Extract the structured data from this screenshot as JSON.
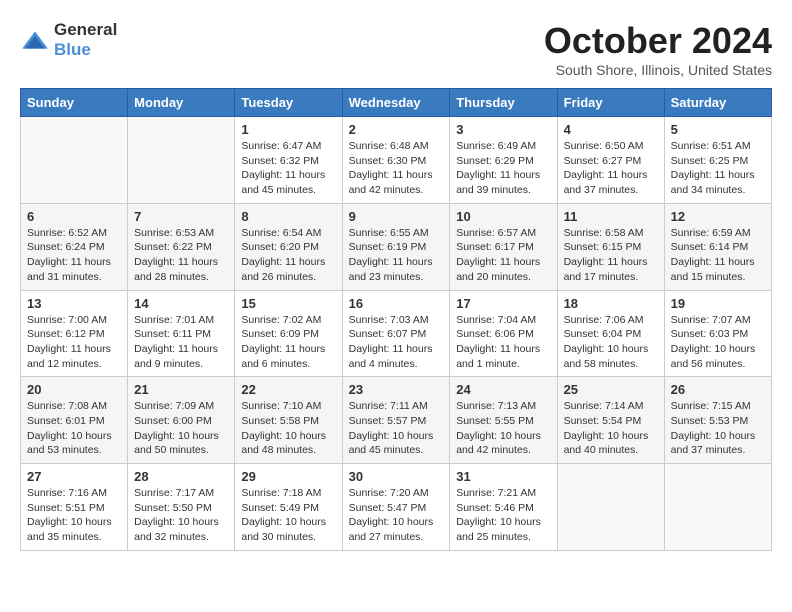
{
  "header": {
    "logo": {
      "general": "General",
      "blue": "Blue"
    },
    "title": "October 2024",
    "location": "South Shore, Illinois, United States"
  },
  "weekdays": [
    "Sunday",
    "Monday",
    "Tuesday",
    "Wednesday",
    "Thursday",
    "Friday",
    "Saturday"
  ],
  "weeks": [
    [
      {
        "day": null
      },
      {
        "day": null
      },
      {
        "day": "1",
        "sunrise": "6:47 AM",
        "sunset": "6:32 PM",
        "daylight": "11 hours and 45 minutes."
      },
      {
        "day": "2",
        "sunrise": "6:48 AM",
        "sunset": "6:30 PM",
        "daylight": "11 hours and 42 minutes."
      },
      {
        "day": "3",
        "sunrise": "6:49 AM",
        "sunset": "6:29 PM",
        "daylight": "11 hours and 39 minutes."
      },
      {
        "day": "4",
        "sunrise": "6:50 AM",
        "sunset": "6:27 PM",
        "daylight": "11 hours and 37 minutes."
      },
      {
        "day": "5",
        "sunrise": "6:51 AM",
        "sunset": "6:25 PM",
        "daylight": "11 hours and 34 minutes."
      }
    ],
    [
      {
        "day": "6",
        "sunrise": "6:52 AM",
        "sunset": "6:24 PM",
        "daylight": "11 hours and 31 minutes."
      },
      {
        "day": "7",
        "sunrise": "6:53 AM",
        "sunset": "6:22 PM",
        "daylight": "11 hours and 28 minutes."
      },
      {
        "day": "8",
        "sunrise": "6:54 AM",
        "sunset": "6:20 PM",
        "daylight": "11 hours and 26 minutes."
      },
      {
        "day": "9",
        "sunrise": "6:55 AM",
        "sunset": "6:19 PM",
        "daylight": "11 hours and 23 minutes."
      },
      {
        "day": "10",
        "sunrise": "6:57 AM",
        "sunset": "6:17 PM",
        "daylight": "11 hours and 20 minutes."
      },
      {
        "day": "11",
        "sunrise": "6:58 AM",
        "sunset": "6:15 PM",
        "daylight": "11 hours and 17 minutes."
      },
      {
        "day": "12",
        "sunrise": "6:59 AM",
        "sunset": "6:14 PM",
        "daylight": "11 hours and 15 minutes."
      }
    ],
    [
      {
        "day": "13",
        "sunrise": "7:00 AM",
        "sunset": "6:12 PM",
        "daylight": "11 hours and 12 minutes."
      },
      {
        "day": "14",
        "sunrise": "7:01 AM",
        "sunset": "6:11 PM",
        "daylight": "11 hours and 9 minutes."
      },
      {
        "day": "15",
        "sunrise": "7:02 AM",
        "sunset": "6:09 PM",
        "daylight": "11 hours and 6 minutes."
      },
      {
        "day": "16",
        "sunrise": "7:03 AM",
        "sunset": "6:07 PM",
        "daylight": "11 hours and 4 minutes."
      },
      {
        "day": "17",
        "sunrise": "7:04 AM",
        "sunset": "6:06 PM",
        "daylight": "11 hours and 1 minute."
      },
      {
        "day": "18",
        "sunrise": "7:06 AM",
        "sunset": "6:04 PM",
        "daylight": "10 hours and 58 minutes."
      },
      {
        "day": "19",
        "sunrise": "7:07 AM",
        "sunset": "6:03 PM",
        "daylight": "10 hours and 56 minutes."
      }
    ],
    [
      {
        "day": "20",
        "sunrise": "7:08 AM",
        "sunset": "6:01 PM",
        "daylight": "10 hours and 53 minutes."
      },
      {
        "day": "21",
        "sunrise": "7:09 AM",
        "sunset": "6:00 PM",
        "daylight": "10 hours and 50 minutes."
      },
      {
        "day": "22",
        "sunrise": "7:10 AM",
        "sunset": "5:58 PM",
        "daylight": "10 hours and 48 minutes."
      },
      {
        "day": "23",
        "sunrise": "7:11 AM",
        "sunset": "5:57 PM",
        "daylight": "10 hours and 45 minutes."
      },
      {
        "day": "24",
        "sunrise": "7:13 AM",
        "sunset": "5:55 PM",
        "daylight": "10 hours and 42 minutes."
      },
      {
        "day": "25",
        "sunrise": "7:14 AM",
        "sunset": "5:54 PM",
        "daylight": "10 hours and 40 minutes."
      },
      {
        "day": "26",
        "sunrise": "7:15 AM",
        "sunset": "5:53 PM",
        "daylight": "10 hours and 37 minutes."
      }
    ],
    [
      {
        "day": "27",
        "sunrise": "7:16 AM",
        "sunset": "5:51 PM",
        "daylight": "10 hours and 35 minutes."
      },
      {
        "day": "28",
        "sunrise": "7:17 AM",
        "sunset": "5:50 PM",
        "daylight": "10 hours and 32 minutes."
      },
      {
        "day": "29",
        "sunrise": "7:18 AM",
        "sunset": "5:49 PM",
        "daylight": "10 hours and 30 minutes."
      },
      {
        "day": "30",
        "sunrise": "7:20 AM",
        "sunset": "5:47 PM",
        "daylight": "10 hours and 27 minutes."
      },
      {
        "day": "31",
        "sunrise": "7:21 AM",
        "sunset": "5:46 PM",
        "daylight": "10 hours and 25 minutes."
      },
      {
        "day": null
      },
      {
        "day": null
      }
    ]
  ]
}
